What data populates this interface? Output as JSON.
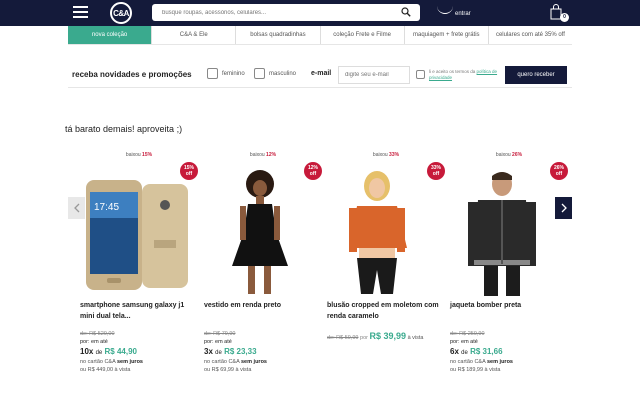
{
  "header": {
    "logo": "C&A",
    "search_placeholder": "busque roupas, acessórios, celulares...",
    "account_label": "entrar",
    "cart_count": "0"
  },
  "nav": {
    "categories": [
      "nova coleção",
      "C&A & Ele",
      "bolsas quadradinhas",
      "coleção Frete e Filme",
      "maquiagem + frete grátis",
      "celulares com até 35% off"
    ]
  },
  "newsletter": {
    "title": "receba novidades e promoções",
    "option_female": "feminino",
    "option_male": "masculino",
    "email_label": "e-mail",
    "email_placeholder": "digite seu e-mail",
    "consent_text": "li e aceito os termos da",
    "consent_link": "política de privacidade",
    "submit_label": "quero receber"
  },
  "section": {
    "title": "tá barato demais! aproveita ;)"
  },
  "products": [
    {
      "drop_label": "baixou",
      "drop_pct": "15%",
      "badge_pct": "15%",
      "badge_off": "off",
      "name": "smartphone samsung galaxy j1 mini dual tela...",
      "old_price": "de: R$ 529,00",
      "por_label": "por: em até",
      "installments": "10x",
      "de_label": "de",
      "installment_value": "R$ 44,90",
      "card_line_prefix": "no cartão C&A",
      "card_line_bold": "sem juros",
      "cash_price": "ou R$ 449,00 à vista"
    },
    {
      "drop_label": "baixou",
      "drop_pct": "12%",
      "badge_pct": "12%",
      "badge_off": "off",
      "name": "vestido em renda preto",
      "old_price": "de: R$ 79,90",
      "por_label": "por: em até",
      "installments": "3x",
      "de_label": "de",
      "installment_value": "R$ 23,33",
      "card_line_prefix": "no cartão C&A",
      "card_line_bold": "sem juros",
      "cash_price": "ou R$ 69,99 à vista"
    },
    {
      "drop_label": "baixou",
      "drop_pct": "33%",
      "badge_pct": "33%",
      "badge_off": "off",
      "name": "blusão cropped em moletom com renda caramelo",
      "old_price": "de: R$ 59,99",
      "por_label": "por",
      "sale_price": "R$ 39,99",
      "cash_label": "à vista"
    },
    {
      "drop_label": "baixou",
      "drop_pct": "26%",
      "badge_pct": "26%",
      "badge_off": "off",
      "name": "jaqueta bomber preta",
      "old_price": "de: R$ 259,90",
      "por_label": "por: em até",
      "installments": "6x",
      "de_label": "de",
      "installment_value": "R$ 31,66",
      "card_line_prefix": "no cartão C&A",
      "card_line_bold": "sem juros",
      "cash_price": "ou R$ 189,99 à vista"
    }
  ],
  "colors": {
    "navy": "#141a3a",
    "teal": "#3aaa8e",
    "red": "#c71a3a"
  }
}
